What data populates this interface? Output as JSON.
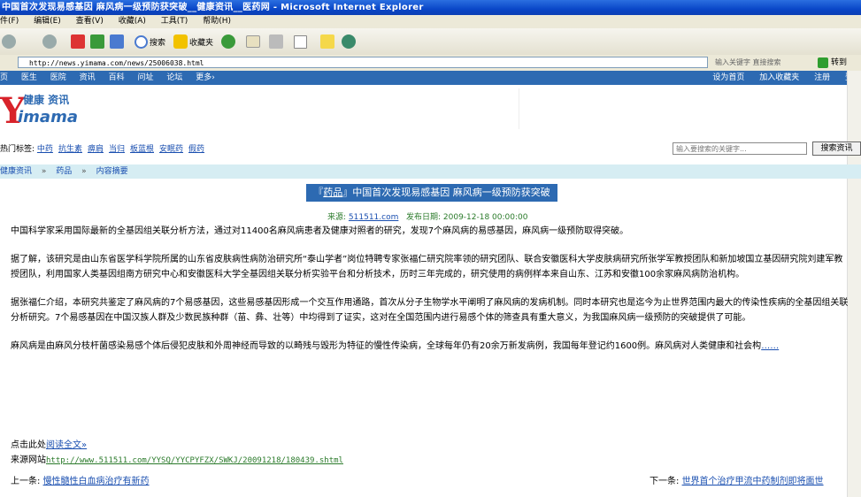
{
  "window": {
    "title": "中国首次发现易感基因 麻风病一级预防获突破__健康资讯__医药网 - Microsoft Internet Explorer"
  },
  "menu": [
    "件(F)",
    "编辑(E)",
    "查看(V)",
    "收藏(A)",
    "工具(T)",
    "帮助(H)"
  ],
  "toolbar": {
    "search": "搜索",
    "favorites": "收藏夹"
  },
  "address": {
    "url": "http://news.yimama.com/news/25006038.html",
    "keyword_hint": "输入关键字 直接搜索",
    "go": "转到"
  },
  "sitenav": {
    "left": [
      "页",
      "医生",
      "医院",
      "资讯",
      "百科",
      "问址",
      "论坛",
      "更多›"
    ],
    "right": [
      "设为首页",
      "加入收藏夹",
      "注册",
      "登录"
    ]
  },
  "logo": {
    "y": "Y",
    "rest": "imama",
    "cn": "健康 资讯"
  },
  "tags": {
    "label": "热门标签:",
    "items": [
      "中药",
      "抗生素",
      "痹肩",
      "当归",
      "板蓝根",
      "安眠药",
      "假药"
    ]
  },
  "search": {
    "placeholder": "输入要搜索的关键字...",
    "button": "搜索资讯"
  },
  "breadcrumb": [
    "健康资讯",
    "»",
    "药品",
    "»",
    "内容摘要"
  ],
  "article": {
    "tag": "药品",
    "title": "中国首次发现易感基因 麻风病一级预防获突破",
    "source_label": "来源:",
    "source": "511511.com",
    "date_label": "发布日期:",
    "date": "2009-12-18 00:00:00",
    "paragraphs": [
      "中国科学家采用国际最新的全基因组关联分析方法，通过对11400名麻风病患者及健康对照者的研究，发现7个麻风病的易感基因，麻风病一级预防取得突破。",
      "据了解，该研究是由山东省医学科学院所属的山东省皮肤病性病防治研究所“泰山学者”岗位特聘专家张福仁研究院率领的研究团队、联合安徽医科大学皮肤病研究所张学军教授团队和新加坡国立基因研究院刘建军教授团队，利用国家人类基因组南方研究中心和安徽医科大学全基因组关联分析实验平台和分析技术，历时三年完成的，研究使用的病例样本来自山东、江苏和安徽100余家麻风病防治机构。",
      "据张福仁介绍，本研究共鉴定了麻风病的7个易感基因，这些易感基因形成一个交互作用通路，首次从分子生物学水平阐明了麻风病的发病机制。同时本研究也是迄今为止世界范围内最大的传染性疾病的全基因组关联分析研究。7个易感基因在中国汉族人群及少数民族种群（苗、彝、壮等）中均得到了证实，这对在全国范围内进行易感个体的筛查具有重大意义，为我国麻风病一级预防的突破提供了可能。",
      "麻风病是由麻风分枝杆菌感染易感个体后侵犯皮肤和外周神经而导致的以畸残与毁形为特征的慢性传染病，全球每年仍有20余万新发病例，我国每年登记约1600例。麻风病对人类健康和社会构"
    ],
    "ellipsis": "……",
    "read_more_prefix": "点击此处",
    "read_more": "阅读全文»",
    "source_site_label": "来源网站",
    "source_site_url": "http://www.511511.com/YYSQ/YYCPYFZX/SWKJ/20091218/180439.shtml"
  },
  "pager": {
    "prev_label": "上一条:",
    "prev": "慢性髓性白血病治疗有新药",
    "next_label": "下一条:",
    "next": "世界首个治疗甲流中药制剂即将面世"
  },
  "colors": {
    "site_blue": "#2d6ab2",
    "logo_red": "#d8232a",
    "link": "#1a4fb0",
    "breadcrumb_bg": "#d6edf3"
  }
}
